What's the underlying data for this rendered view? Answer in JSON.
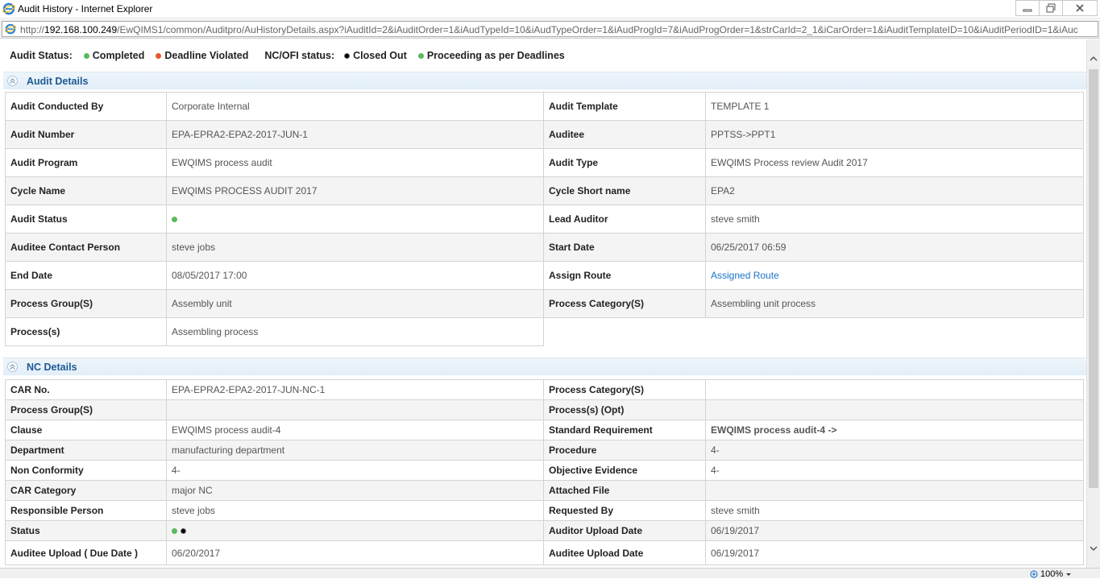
{
  "window": {
    "title": "Audit History - Internet Explorer",
    "url_prefix": "http://",
    "url_host": "192.168.100.249",
    "url_rest": "/EwQIMS1/common/Auditpro/AuHistoryDetails.aspx?iAuditId=2&iAuditOrder=1&iAudTypeId=10&iAudTypeOrder=1&iAudProgId=7&iAudProgOrder=1&strCarId=2_1&iCarOrder=1&iAuditTemplateID=10&iAuditPeriodID=1&iAuc",
    "zoom": "100%"
  },
  "legend": {
    "audit_status_label": "Audit Status:",
    "completed": "Completed",
    "deadline_violated": "Deadline Violated",
    "nc_status_label": "NC/OFI status:",
    "closed_out": "Closed Out",
    "proceeding": "Proceeding as per Deadlines"
  },
  "audit_details": {
    "header": "Audit Details",
    "rows": [
      {
        "l1": "Audit Conducted By",
        "v1": "Corporate Internal",
        "l2": "Audit Template",
        "v2": "TEMPLATE 1"
      },
      {
        "l1": "Audit Number",
        "v1": "EPA-EPRA2-EPA2-2017-JUN-1",
        "l2": "Auditee",
        "v2": "PPTSS->PPT1"
      },
      {
        "l1": "Audit Program",
        "v1": "EWQIMS process audit",
        "l2": "Audit Type",
        "v2": "EWQIMS Process review Audit 2017"
      },
      {
        "l1": "Cycle Name",
        "v1": "EWQIMS PROCESS AUDIT 2017",
        "l2": "Cycle Short name",
        "v2": "EPA2"
      },
      {
        "l1": "Audit Status",
        "v1": "",
        "l2": "Lead Auditor",
        "v2": "steve smith"
      },
      {
        "l1": "Auditee Contact Person",
        "v1": "steve jobs",
        "l2": "Start Date",
        "v2": "06/25/2017 06:59"
      },
      {
        "l1": "End Date",
        "v1": "08/05/2017 17:00",
        "l2": "Assign Route",
        "v2": "Assigned Route"
      },
      {
        "l1": "Process Group(S)",
        "v1": "Assembly unit",
        "l2": "Process Category(S)",
        "v2": "Assembling unit process"
      },
      {
        "l1": "Process(s)",
        "v1": "Assembling process"
      }
    ]
  },
  "nc_details": {
    "header": "NC Details",
    "rows": [
      {
        "l1": "CAR No.",
        "v1": "EPA-EPRA2-EPA2-2017-JUN-NC-1",
        "l2": "Process Category(S)",
        "v2": ""
      },
      {
        "l1": "Process Group(S)",
        "v1": "",
        "l2": "Process(s) (Opt)",
        "v2": ""
      },
      {
        "l1": "Clause",
        "v1": "EWQIMS process audit-4",
        "l2": "Standard Requirement",
        "v2": "EWQIMS process audit-4 ->"
      },
      {
        "l1": "Department",
        "v1": "manufacturing department",
        "l2": "Procedure",
        "v2": "4-"
      },
      {
        "l1": "Non Conformity",
        "v1": "4-",
        "l2": "Objective Evidence",
        "v2": "4-"
      },
      {
        "l1": "CAR Category",
        "v1": "major NC",
        "l2": "Attached File",
        "v2": ""
      },
      {
        "l1": "Responsible Person",
        "v1": "steve jobs",
        "l2": "Requested By",
        "v2": "steve smith"
      },
      {
        "l1": "Status",
        "v1": "",
        "l2": "Auditor Upload Date",
        "v2": "06/19/2017"
      },
      {
        "l1": "Auditee Upload ( Due Date )",
        "v1": "06/20/2017",
        "l2": "Auditee Upload Date",
        "v2": "06/19/2017"
      }
    ]
  },
  "colors": {
    "green": "#5cb85c",
    "red": "#e8572b",
    "black": "#000000",
    "link": "#1a73c9",
    "section_header_text": "#1e5a94"
  },
  "icons": [
    "ie-icon",
    "minimize-icon",
    "maximize-icon",
    "close-icon",
    "collapse-chevron-icon",
    "scroll-up-icon",
    "scroll-down-icon",
    "zoom-icon"
  ]
}
